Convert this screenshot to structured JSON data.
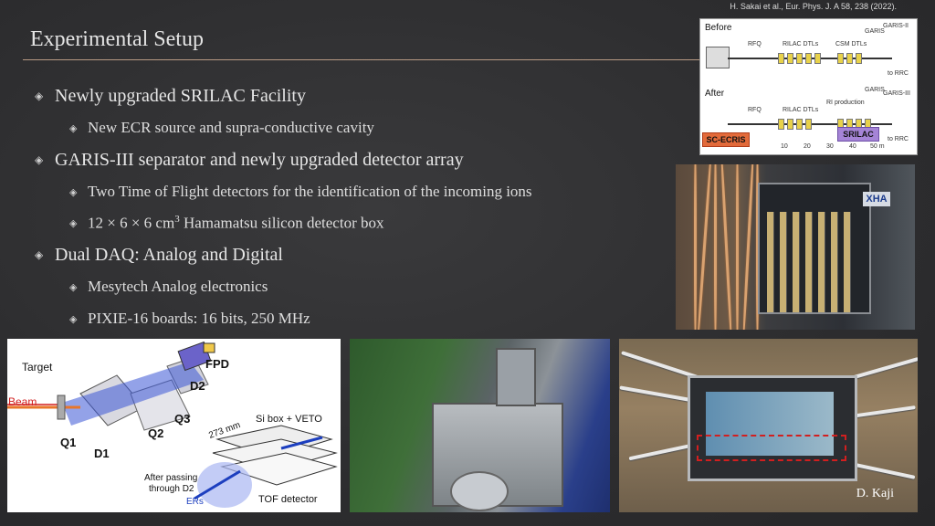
{
  "citation": "H. Sakai et al., Eur. Phys. J. A 58, 238 (2022).",
  "title": "Experimental Setup",
  "bullets": [
    {
      "level": 1,
      "text": "Newly upgraded SRILAC Facility"
    },
    {
      "level": 2,
      "text": "New ECR source and supra-conductive cavity"
    },
    {
      "level": 1,
      "text": "GARIS-III separator and newly upgraded detector array"
    },
    {
      "level": 2,
      "text": "Two Time of Flight detectors for the identification of the incoming ions"
    },
    {
      "level": 2,
      "text_pre": "12 × 6 × 6 cm",
      "sup": "3",
      "text_post": " Hamamatsu silicon detector box"
    },
    {
      "level": 1,
      "text": "Dual DAQ: Analog and Digital"
    },
    {
      "level": 2,
      "text": "Mesytech Analog electronics"
    },
    {
      "level": 2,
      "text": "PIXIE-16 boards: 16 bits, 250 MHz"
    }
  ],
  "bullet_glyph": "◈",
  "beamline_figure": {
    "before": "Before",
    "after": "After",
    "labels_before": [
      "RFQ",
      "RILAC DTLs",
      "CSM DTLs",
      "GARIS",
      "GARIS-II",
      "to RRC"
    ],
    "labels_after": [
      "RFQ",
      "RILAC DTLs",
      "GARIS",
      "RI production",
      "GARIS-III",
      "to RRC"
    ],
    "sc_ecris": "SC-ECRIS",
    "srilac": "SRILAC",
    "scale_ticks": [
      "10",
      "20",
      "30",
      "40",
      "50 m"
    ]
  },
  "garis_figure": {
    "target": "Target",
    "beam": "Beam",
    "fpd": "FPD",
    "d2": "D2",
    "q3": "Q3",
    "q2": "Q2",
    "q1": "Q1",
    "d1": "D1",
    "distance": "273 mm",
    "si_box": "Si box + VETO",
    "after_passing": "After passing",
    "through_d2": "through D2",
    "ers": "ERs",
    "tof": "TOF detector"
  },
  "electronics_logo": "XHA",
  "photo_credit": "D. Kaji",
  "colors": {
    "background": "#2e2e30",
    "rule": "#b89a84",
    "beam_red": "#d21f1f",
    "sc_ecris": "#e26a3a",
    "srilac": "#a584d6"
  }
}
